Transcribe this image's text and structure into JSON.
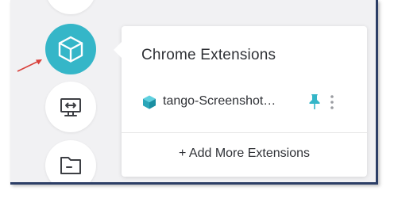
{
  "popup": {
    "title": "Chrome Extensions",
    "extensions": [
      {
        "name": "tango-Screenshot…",
        "icon": "cube-icon",
        "pinned": true
      }
    ],
    "add_more_label": "+ Add More Extensions"
  },
  "rail": {
    "items": [
      {
        "icon": "rail-item-partial"
      },
      {
        "icon": "extensions-cube-icon",
        "active": true
      },
      {
        "icon": "remote-desktop-icon"
      },
      {
        "icon": "folder-icon"
      }
    ]
  },
  "colors": {
    "accent": "#35b6c8",
    "annotation_arrow": "#d9413b",
    "frame_border": "#2c3e66",
    "text": "#2f3136"
  }
}
